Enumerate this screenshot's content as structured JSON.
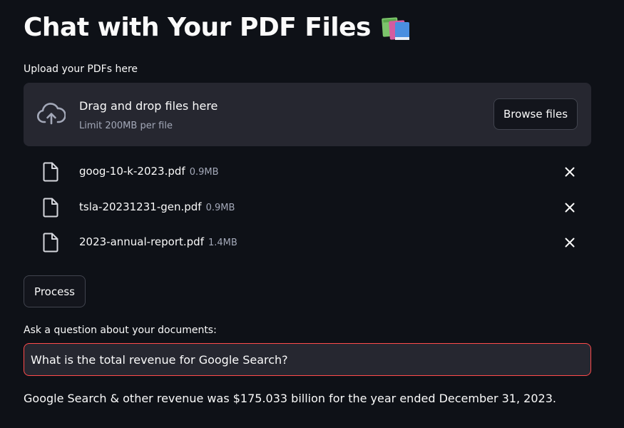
{
  "page": {
    "title": "Chat with Your PDF Files",
    "title_icon": "books-icon"
  },
  "upload": {
    "label": "Upload your PDFs here",
    "drop_text": "Drag and drop files here",
    "limit_text": "Limit 200MB per file",
    "browse_label": "Browse files",
    "icon": "cloud-upload-icon"
  },
  "files": [
    {
      "name": "goog-10-k-2023.pdf",
      "size": "0.9MB"
    },
    {
      "name": "tsla-20231231-gen.pdf",
      "size": "0.9MB"
    },
    {
      "name": "2023-annual-report.pdf",
      "size": "1.4MB"
    }
  ],
  "process": {
    "label": "Process"
  },
  "question": {
    "label": "Ask a question about your documents:",
    "value": "What is the total revenue for Google Search?"
  },
  "answer": {
    "text": "Google Search & other revenue was $175.033 billion for the year ended December 31, 2023."
  },
  "colors": {
    "background": "#0e1117",
    "panel": "#262730",
    "focus_border": "#ff4b4b",
    "muted_text": "#a3a8b8"
  }
}
